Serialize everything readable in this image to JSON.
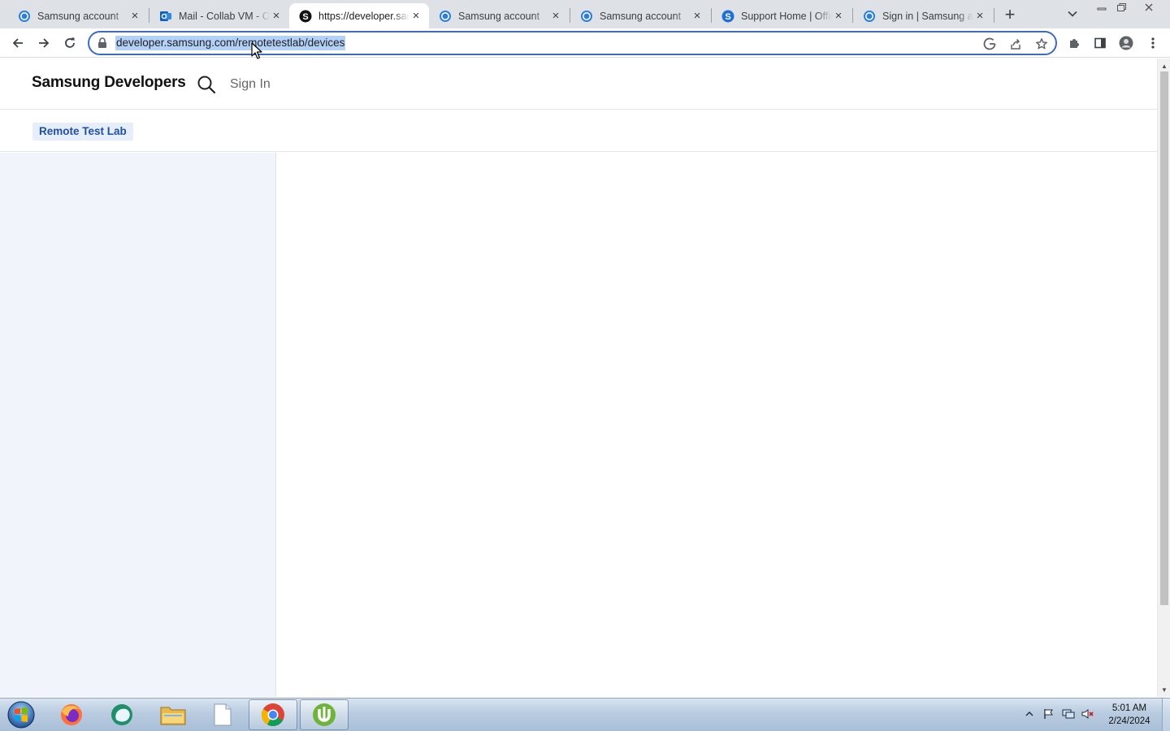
{
  "browser": {
    "tabs": [
      {
        "title": "Samsung account",
        "favicon": "samsung-account-icon",
        "active": false
      },
      {
        "title": "Mail - Collab VM - Outlook",
        "favicon": "outlook-icon",
        "active": false
      },
      {
        "title": "https://developer.samsung.com",
        "favicon": "samsung-developers-icon",
        "active": true
      },
      {
        "title": "Samsung account",
        "favicon": "samsung-account-icon",
        "active": false
      },
      {
        "title": "Samsung account",
        "favicon": "samsung-account-icon",
        "active": false
      },
      {
        "title": "Support Home | Official Samsung",
        "favicon": "samsung-support-icon",
        "active": false
      },
      {
        "title": "Sign in | Samsung account",
        "favicon": "samsung-account-icon",
        "active": false
      }
    ],
    "new_tab_glyph": "+",
    "close_glyph": "×",
    "address": "developer.samsung.com/remotetestlab/devices",
    "colors": {
      "tabstrip": "#dee1e6",
      "selection": "#b3d0f7",
      "focus_ring": "#3c6ac4"
    }
  },
  "page": {
    "brand": "Samsung Developers",
    "sign_in": "Sign In",
    "subnav_chip": "Remote Test Lab",
    "colors": {
      "chip_bg": "#e6eefb",
      "chip_text": "#1f4fa3",
      "sidebar_bg": "#f1f5fb"
    }
  },
  "taskbar": {
    "apps": [
      {
        "name": "firefox-icon",
        "running": false
      },
      {
        "name": "messenger-icon",
        "running": false
      },
      {
        "name": "file-explorer-icon",
        "running": false
      },
      {
        "name": "notepad-icon",
        "running": false
      },
      {
        "name": "chrome-icon",
        "running": true
      },
      {
        "name": "utorrent-icon",
        "running": true
      }
    ],
    "clock_time": "5:01 AM",
    "clock_date": "2/24/2024"
  }
}
